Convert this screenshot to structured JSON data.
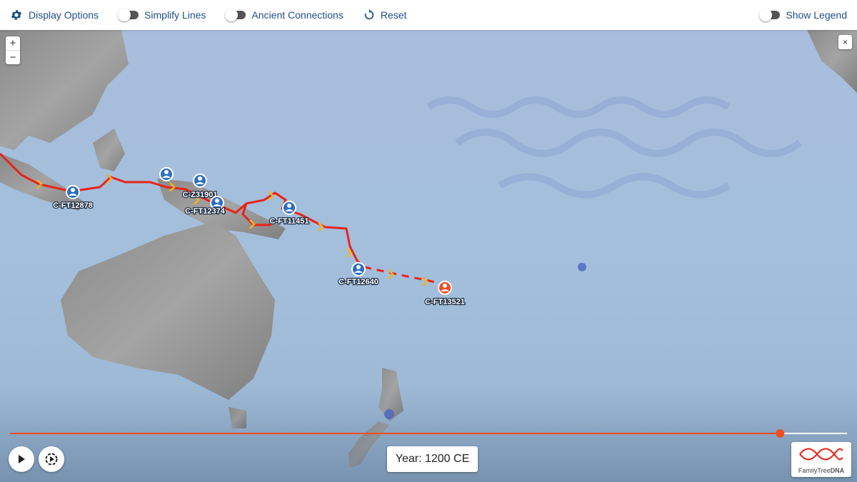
{
  "toolbar": {
    "display_options": "Display Options",
    "simplify_lines": "Simplify Lines",
    "ancient_connections": "Ancient Connections",
    "reset": "Reset",
    "show_legend": "Show Legend"
  },
  "zoom": {
    "in": "+",
    "out": "−"
  },
  "close": "×",
  "markers": [
    {
      "label": "C-FT12878",
      "color": "blue"
    },
    {
      "label": "C-Z31901",
      "color": "blue"
    },
    {
      "label": "C-FT12374",
      "color": "blue"
    },
    {
      "label": "C-FT11451",
      "color": "blue"
    },
    {
      "label": "C-FT12640",
      "color": "blue"
    },
    {
      "label": "C-FT13521",
      "color": "orange"
    }
  ],
  "timeline": {
    "progress": 0.92,
    "year_label": "Year: 1200 CE"
  },
  "logo": {
    "line1": "FamilyTree",
    "line2": "DNA"
  },
  "colors": {
    "accent": "#1f4e8a",
    "route": "#e8231a",
    "timeline": "#f04e23",
    "marker_blue": "#2e6fc0",
    "marker_orange": "#f04e23"
  }
}
